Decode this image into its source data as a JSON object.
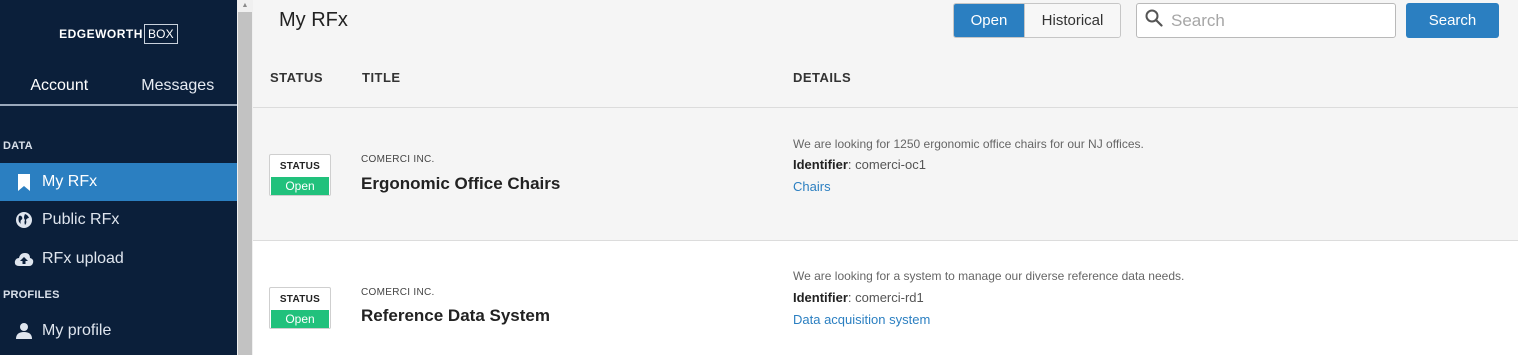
{
  "sidebar": {
    "logo": {
      "main": "EDGEWORTH",
      "box": "BOX"
    },
    "tabs": {
      "account": "Account",
      "messages": "Messages"
    },
    "sections": {
      "data": "DATA",
      "profiles": "PROFILES"
    },
    "items": {
      "my_rfx": "My RFx",
      "public_rfx": "Public RFx",
      "rfx_upload": "RFx upload",
      "my_profile": "My profile"
    }
  },
  "header": {
    "title": "My RFx",
    "filter": {
      "open": "Open",
      "historical": "Historical",
      "selected": "Open"
    },
    "search": {
      "placeholder": "Search",
      "value": "",
      "button": "Search"
    }
  },
  "table": {
    "columns": {
      "status": "STATUS",
      "title": "TITLE",
      "details": "DETAILS"
    },
    "rows": [
      {
        "status_label": "STATUS",
        "status_value": "Open",
        "company": "COMERCI INC.",
        "title": "Ergonomic Office Chairs",
        "description": "We are looking for 1250 ergonomic office chairs for our NJ offices.",
        "identifier_label": "Identifier",
        "identifier_value": ": comerci-oc1",
        "tag": "Chairs"
      },
      {
        "status_label": "STATUS",
        "status_value": "Open",
        "company": "COMERCI INC.",
        "title": "Reference Data System",
        "description": "We are looking for a system to manage our diverse reference data needs.",
        "identifier_label": "Identifier",
        "identifier_value": ": comerci-rd1",
        "tag": "Data acquisition system"
      }
    ]
  },
  "colors": {
    "sidebar_bg": "#0b1f3a",
    "accent": "#2b7fc1",
    "status_open": "#21c17c"
  }
}
